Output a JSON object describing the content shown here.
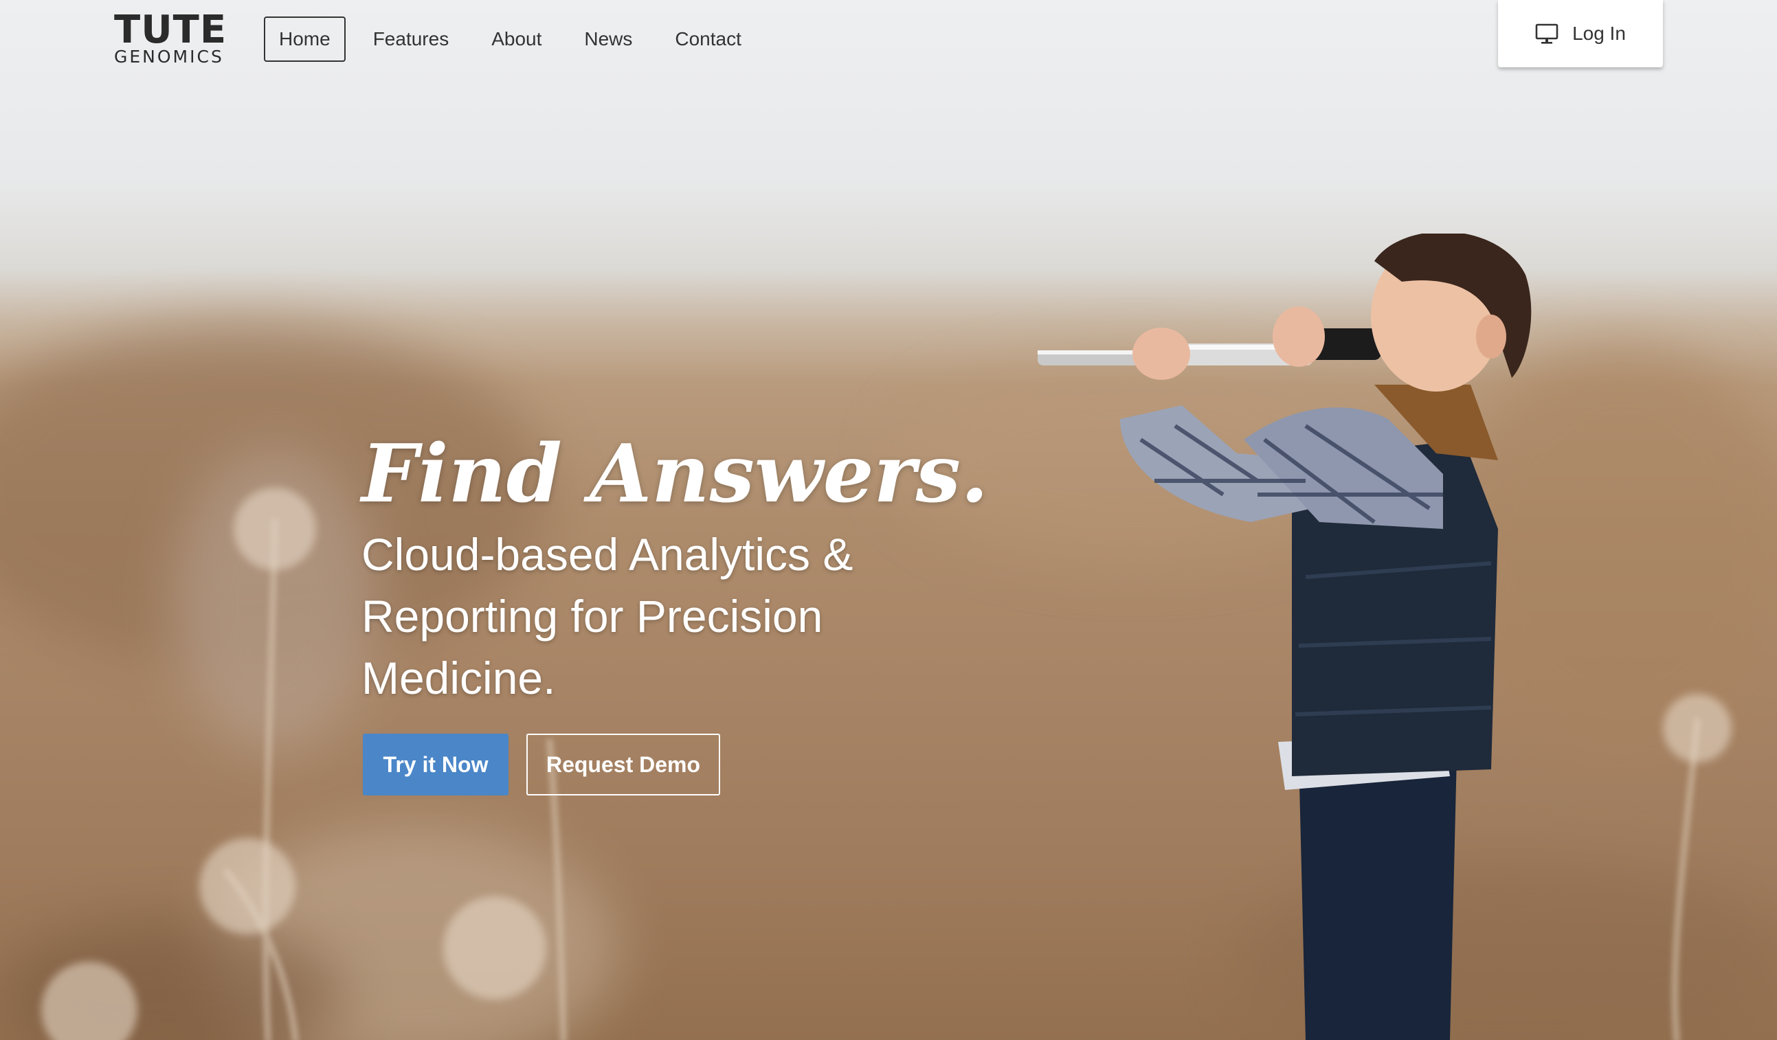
{
  "logo": {
    "main": "TUTE",
    "sub": "GENOMICS"
  },
  "nav": {
    "items": [
      {
        "label": "Home",
        "active": true
      },
      {
        "label": "Features",
        "active": false
      },
      {
        "label": "About",
        "active": false
      },
      {
        "label": "News",
        "active": false
      },
      {
        "label": "Contact",
        "active": false
      }
    ]
  },
  "login": {
    "label": "Log In",
    "icon": "monitor-icon"
  },
  "hero": {
    "headline": "Find Answers.",
    "subhead": "Cloud-based Analytics & Reporting for Precision Medicine.",
    "primary_button": "Try it Now",
    "secondary_button": "Request Demo"
  },
  "colors": {
    "primary_button": "#4a86c8",
    "nav_text": "#333333",
    "hero_text": "#ffffff"
  }
}
